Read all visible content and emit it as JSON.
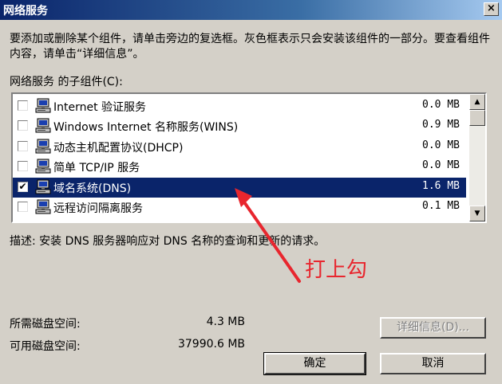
{
  "window": {
    "title": "网络服务",
    "close_glyph": "×"
  },
  "description_text": "要添加或删除某个组件，请单击旁边的复选框。灰色框表示只会安装该组件的一部分。要查看组件内容，请单击“详细信息”。",
  "subcomponents_label": "网络服务 的子组件(C):",
  "components": [
    {
      "name": "Internet 验证服务",
      "size": "0.0 MB",
      "checked": false,
      "selected": false
    },
    {
      "name": "Windows Internet 名称服务(WINS)",
      "size": "0.9 MB",
      "checked": false,
      "selected": false
    },
    {
      "name": "动态主机配置协议(DHCP)",
      "size": "0.0 MB",
      "checked": false,
      "selected": false
    },
    {
      "name": "简单 TCP/IP 服务",
      "size": "0.0 MB",
      "checked": false,
      "selected": false
    },
    {
      "name": "域名系统(DNS)",
      "size": "1.6 MB",
      "checked": true,
      "selected": true
    },
    {
      "name": "远程访问隔离服务",
      "size": "0.1 MB",
      "checked": false,
      "selected": false
    }
  ],
  "component_description": "描述:  安装 DNS 服务器响应对 DNS 名称的查询和更新的请求。",
  "annotation": {
    "text": "打上勾",
    "color": "#e8262e"
  },
  "disk_space": {
    "required_label": "所需磁盘空间:",
    "required_value": "4.3 MB",
    "available_label": "可用磁盘空间:",
    "available_value": "37990.6 MB"
  },
  "buttons": {
    "details": "详细信息(D)...",
    "ok": "确定",
    "cancel": "取消"
  },
  "colors": {
    "selection": "#0a246a",
    "dialog": "#d4d0c8"
  }
}
